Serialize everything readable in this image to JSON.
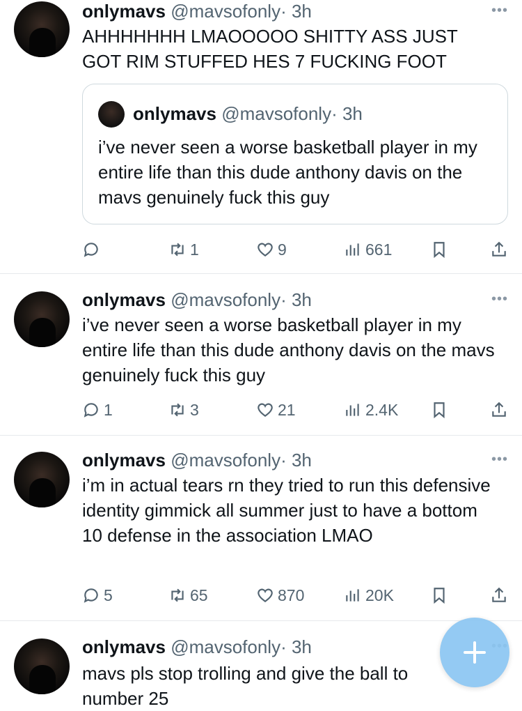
{
  "tweets": [
    {
      "name": "onlymavs",
      "handle": "@mavsofonly",
      "time": "· 3h",
      "text": "AHHHHHHH LMAOOOOO SHITTY ASS JUST GOT RIM STUFFED HES 7 FUCKING FOOT",
      "quote": {
        "name": "onlymavs",
        "handle": "@mavsofonly",
        "time": "· 3h",
        "text": "i’ve never seen a worse basketball player in my entire life than this dude anthony davis on the mavs genuinely fuck this guy"
      },
      "replies": "",
      "retweets": "1",
      "likes": "9",
      "views": "661"
    },
    {
      "name": "onlymavs",
      "handle": "@mavsofonly",
      "time": "· 3h",
      "text": "i’ve never seen a worse basketball player in my entire life than this dude anthony davis on the mavs genuinely fuck this guy",
      "replies": "1",
      "retweets": "3",
      "likes": "21",
      "views": "2.4K"
    },
    {
      "name": "onlymavs",
      "handle": "@mavsofonly",
      "time": "· 3h",
      "text": "i’m in actual tears rn they tried to run this defensive identity gimmick all summer just to have a bottom 10 defense in the association LMAO",
      "replies": "5",
      "retweets": "65",
      "likes": "870",
      "views": "20K"
    },
    {
      "name": "onlymavs",
      "handle": "@mavsofonly",
      "time": "· 3h",
      "text": "mavs pls stop trolling and give the ball to number 25"
    }
  ],
  "more_label": "•••",
  "compose_label": "+",
  "icons": [
    "reply-icon",
    "retweet-icon",
    "like-icon",
    "views-icon",
    "bookmark-icon",
    "share-icon",
    "more-icon",
    "compose-icon"
  ],
  "colors": {
    "text": "#0f1419",
    "secondary": "#536471",
    "border": "#cfd9de",
    "fab": "#8cc6f2"
  }
}
